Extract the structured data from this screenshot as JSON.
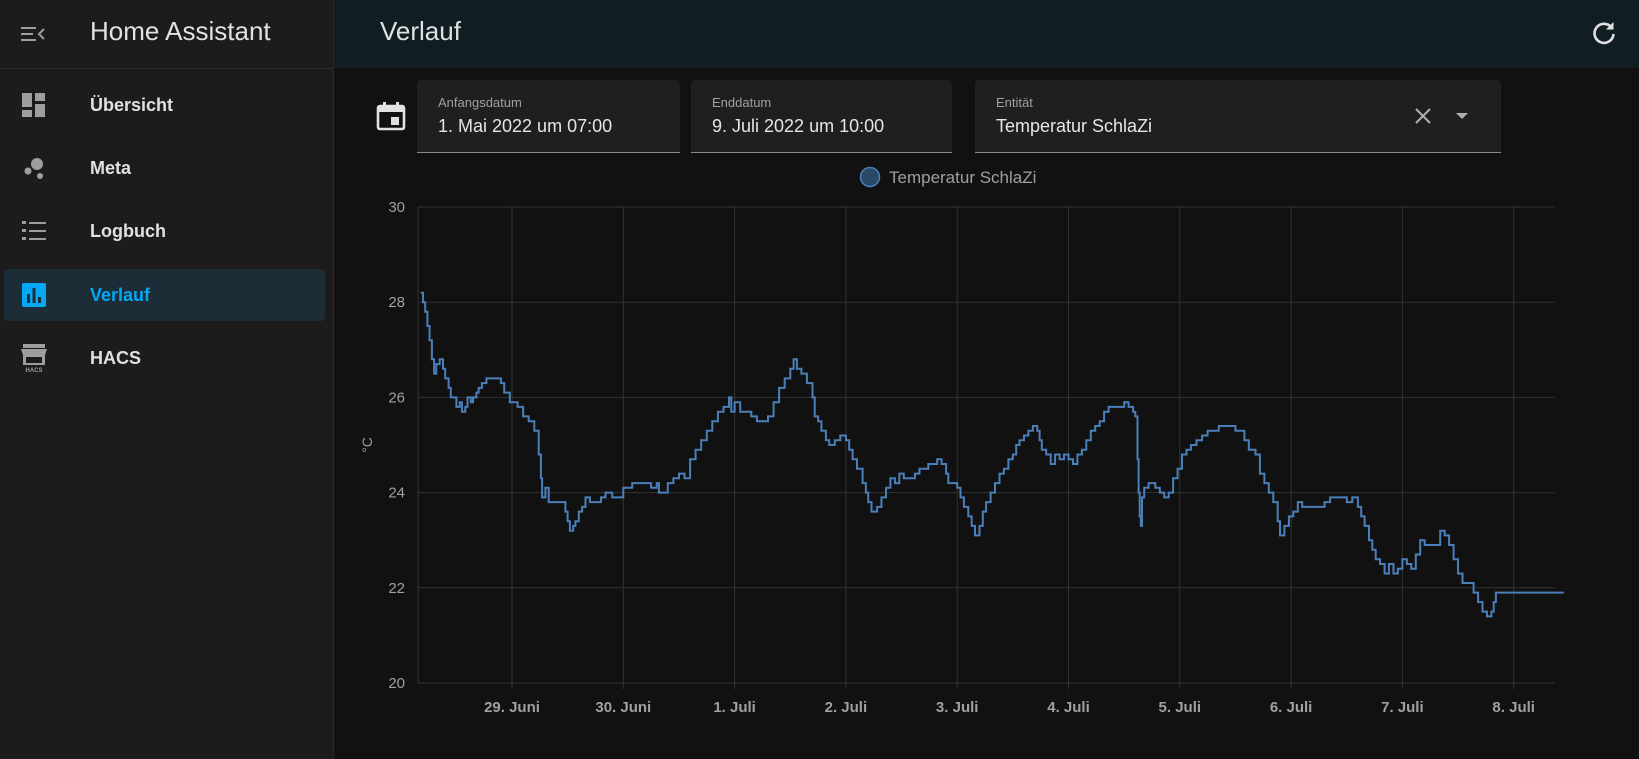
{
  "sidebar": {
    "title": "Home Assistant",
    "menu_icon": "menu-open-icon",
    "items": [
      {
        "label": "Übersicht",
        "icon": "dashboard-icon",
        "active": false
      },
      {
        "label": "Meta",
        "icon": "molecule-icon",
        "active": false
      },
      {
        "label": "Logbuch",
        "icon": "format-list-icon",
        "active": false
      },
      {
        "label": "Verlauf",
        "icon": "chart-box-icon",
        "active": true
      },
      {
        "label": "HACS",
        "icon": "hacs-store-icon",
        "active": false
      }
    ]
  },
  "header": {
    "title": "Verlauf",
    "refresh_icon": "refresh-icon"
  },
  "filters": {
    "calendar_icon": "calendar-icon",
    "start": {
      "label": "Anfangsdatum",
      "value": "1. Mai 2022 um 07:00"
    },
    "end": {
      "label": "Enddatum",
      "value": "9. Juli 2022 um 10:00"
    },
    "entity": {
      "label": "Entität",
      "value": "Temperatur SchlaZi"
    }
  },
  "colors": {
    "accent": "#03a9f4",
    "series": "#4a7fb9",
    "sidebar_bg": "#1c1c1c",
    "topbar_bg": "#101e24",
    "page_bg": "#111111"
  },
  "chart_data": {
    "type": "line",
    "step": true,
    "title": "",
    "xlabel": "",
    "ylabel": "°C",
    "ylim": [
      20,
      30
    ],
    "yticks": [
      20,
      22,
      24,
      26,
      28,
      30
    ],
    "grid": true,
    "legend_position": "top-center",
    "x_ticks": [
      "29. Juni",
      "30. Juni",
      "1. Juli",
      "2. Juli",
      "3. Juli",
      "4. Juli",
      "5. Juli",
      "6. Juli",
      "7. Juli",
      "8. Juli"
    ],
    "x_range_days": [
      -0.82,
      9.45
    ],
    "series": [
      {
        "name": "Temperatur SchlaZi",
        "points": [
          [
            -0.82,
            28.2
          ],
          [
            -0.8,
            28.0
          ],
          [
            -0.78,
            27.8
          ],
          [
            -0.76,
            27.5
          ],
          [
            -0.74,
            27.2
          ],
          [
            -0.72,
            26.8
          ],
          [
            -0.7,
            26.5
          ],
          [
            -0.68,
            26.7
          ],
          [
            -0.65,
            26.8
          ],
          [
            -0.62,
            26.6
          ],
          [
            -0.6,
            26.4
          ],
          [
            -0.57,
            26.2
          ],
          [
            -0.55,
            26.0
          ],
          [
            -0.52,
            26.0
          ],
          [
            -0.5,
            25.8
          ],
          [
            -0.47,
            25.9
          ],
          [
            -0.45,
            25.7
          ],
          [
            -0.42,
            25.8
          ],
          [
            -0.4,
            26.0
          ],
          [
            -0.37,
            25.9
          ],
          [
            -0.35,
            26.0
          ],
          [
            -0.32,
            26.1
          ],
          [
            -0.3,
            26.2
          ],
          [
            -0.27,
            26.3
          ],
          [
            -0.23,
            26.4
          ],
          [
            -0.15,
            26.4
          ],
          [
            -0.1,
            26.3
          ],
          [
            -0.07,
            26.1
          ],
          [
            -0.02,
            25.9
          ],
          [
            0.05,
            25.8
          ],
          [
            0.1,
            25.6
          ],
          [
            0.15,
            25.5
          ],
          [
            0.2,
            25.3
          ],
          [
            0.24,
            24.8
          ],
          [
            0.26,
            24.3
          ],
          [
            0.27,
            23.9
          ],
          [
            0.3,
            24.1
          ],
          [
            0.33,
            23.8
          ],
          [
            0.45,
            23.8
          ],
          [
            0.48,
            23.6
          ],
          [
            0.5,
            23.4
          ],
          [
            0.52,
            23.2
          ],
          [
            0.55,
            23.3
          ],
          [
            0.57,
            23.4
          ],
          [
            0.6,
            23.6
          ],
          [
            0.63,
            23.7
          ],
          [
            0.66,
            23.9
          ],
          [
            0.7,
            23.8
          ],
          [
            0.8,
            23.9
          ],
          [
            0.84,
            24.0
          ],
          [
            0.9,
            23.9
          ],
          [
            1.0,
            24.1
          ],
          [
            1.05,
            24.1
          ],
          [
            1.08,
            24.2
          ],
          [
            1.2,
            24.2
          ],
          [
            1.25,
            24.1
          ],
          [
            1.3,
            24.2
          ],
          [
            1.32,
            24.0
          ],
          [
            1.4,
            24.2
          ],
          [
            1.45,
            24.3
          ],
          [
            1.5,
            24.4
          ],
          [
            1.55,
            24.3
          ],
          [
            1.6,
            24.7
          ],
          [
            1.65,
            24.9
          ],
          [
            1.7,
            25.1
          ],
          [
            1.75,
            25.3
          ],
          [
            1.8,
            25.5
          ],
          [
            1.85,
            25.7
          ],
          [
            1.9,
            25.8
          ],
          [
            1.95,
            26.0
          ],
          [
            1.97,
            25.7
          ],
          [
            2.0,
            25.9
          ],
          [
            2.05,
            25.7
          ],
          [
            2.1,
            25.7
          ],
          [
            2.15,
            25.6
          ],
          [
            2.2,
            25.5
          ],
          [
            2.25,
            25.5
          ],
          [
            2.3,
            25.6
          ],
          [
            2.35,
            25.9
          ],
          [
            2.4,
            26.2
          ],
          [
            2.45,
            26.4
          ],
          [
            2.5,
            26.6
          ],
          [
            2.53,
            26.8
          ],
          [
            2.56,
            26.6
          ],
          [
            2.6,
            26.5
          ],
          [
            2.65,
            26.3
          ],
          [
            2.7,
            26.0
          ],
          [
            2.72,
            25.6
          ],
          [
            2.75,
            25.5
          ],
          [
            2.78,
            25.3
          ],
          [
            2.82,
            25.1
          ],
          [
            2.85,
            25.0
          ],
          [
            2.9,
            25.1
          ],
          [
            2.95,
            25.2
          ],
          [
            3.0,
            25.1
          ],
          [
            3.03,
            24.9
          ],
          [
            3.06,
            24.7
          ],
          [
            3.1,
            24.5
          ],
          [
            3.15,
            24.2
          ],
          [
            3.18,
            24.0
          ],
          [
            3.2,
            23.8
          ],
          [
            3.23,
            23.6
          ],
          [
            3.28,
            23.7
          ],
          [
            3.32,
            23.9
          ],
          [
            3.36,
            24.1
          ],
          [
            3.4,
            24.3
          ],
          [
            3.44,
            24.2
          ],
          [
            3.48,
            24.4
          ],
          [
            3.52,
            24.3
          ],
          [
            3.58,
            24.3
          ],
          [
            3.62,
            24.4
          ],
          [
            3.66,
            24.5
          ],
          [
            3.7,
            24.5
          ],
          [
            3.74,
            24.6
          ],
          [
            3.78,
            24.6
          ],
          [
            3.82,
            24.7
          ],
          [
            3.86,
            24.6
          ],
          [
            3.9,
            24.4
          ],
          [
            3.92,
            24.2
          ],
          [
            3.96,
            24.2
          ],
          [
            4.0,
            24.1
          ],
          [
            4.03,
            23.9
          ],
          [
            4.06,
            23.7
          ],
          [
            4.1,
            23.5
          ],
          [
            4.13,
            23.3
          ],
          [
            4.16,
            23.1
          ],
          [
            4.2,
            23.3
          ],
          [
            4.23,
            23.6
          ],
          [
            4.26,
            23.8
          ],
          [
            4.3,
            24.0
          ],
          [
            4.34,
            24.2
          ],
          [
            4.38,
            24.4
          ],
          [
            4.42,
            24.5
          ],
          [
            4.46,
            24.7
          ],
          [
            4.5,
            24.8
          ],
          [
            4.53,
            25.0
          ],
          [
            4.56,
            25.1
          ],
          [
            4.6,
            25.2
          ],
          [
            4.64,
            25.3
          ],
          [
            4.68,
            25.4
          ],
          [
            4.72,
            25.3
          ],
          [
            4.74,
            25.1
          ],
          [
            4.76,
            24.9
          ],
          [
            4.8,
            24.8
          ],
          [
            4.84,
            24.6
          ],
          [
            4.88,
            24.8
          ],
          [
            4.92,
            24.7
          ],
          [
            4.96,
            24.8
          ],
          [
            5.0,
            24.7
          ],
          [
            5.04,
            24.6
          ],
          [
            5.08,
            24.8
          ],
          [
            5.12,
            24.9
          ],
          [
            5.16,
            25.1
          ],
          [
            5.2,
            25.3
          ],
          [
            5.24,
            25.4
          ],
          [
            5.28,
            25.5
          ],
          [
            5.32,
            25.7
          ],
          [
            5.36,
            25.8
          ],
          [
            5.4,
            25.8
          ],
          [
            5.45,
            25.8
          ],
          [
            5.5,
            25.9
          ],
          [
            5.54,
            25.8
          ],
          [
            5.58,
            25.7
          ],
          [
            5.6,
            25.6
          ],
          [
            5.62,
            24.7
          ],
          [
            5.63,
            24.0
          ],
          [
            5.64,
            23.5
          ],
          [
            5.65,
            23.3
          ],
          [
            5.66,
            23.9
          ],
          [
            5.68,
            24.1
          ],
          [
            5.72,
            24.2
          ],
          [
            5.78,
            24.1
          ],
          [
            5.82,
            24.0
          ],
          [
            5.86,
            23.9
          ],
          [
            5.9,
            24.0
          ],
          [
            5.94,
            24.3
          ],
          [
            5.98,
            24.5
          ],
          [
            6.02,
            24.8
          ],
          [
            6.06,
            24.9
          ],
          [
            6.1,
            25.0
          ],
          [
            6.15,
            25.1
          ],
          [
            6.2,
            25.2
          ],
          [
            6.25,
            25.3
          ],
          [
            6.3,
            25.3
          ],
          [
            6.35,
            25.4
          ],
          [
            6.42,
            25.4
          ],
          [
            6.5,
            25.3
          ],
          [
            6.55,
            25.3
          ],
          [
            6.58,
            25.1
          ],
          [
            6.62,
            24.9
          ],
          [
            6.68,
            24.8
          ],
          [
            6.72,
            24.4
          ],
          [
            6.76,
            24.2
          ],
          [
            6.8,
            24.0
          ],
          [
            6.84,
            23.8
          ],
          [
            6.88,
            23.4
          ],
          [
            6.9,
            23.1
          ],
          [
            6.94,
            23.3
          ],
          [
            6.98,
            23.5
          ],
          [
            7.02,
            23.6
          ],
          [
            7.06,
            23.8
          ],
          [
            7.1,
            23.7
          ],
          [
            7.15,
            23.7
          ],
          [
            7.25,
            23.7
          ],
          [
            7.3,
            23.8
          ],
          [
            7.35,
            23.9
          ],
          [
            7.45,
            23.9
          ],
          [
            7.5,
            23.8
          ],
          [
            7.55,
            23.9
          ],
          [
            7.6,
            23.7
          ],
          [
            7.63,
            23.5
          ],
          [
            7.66,
            23.3
          ],
          [
            7.7,
            23.0
          ],
          [
            7.73,
            22.8
          ],
          [
            7.76,
            22.6
          ],
          [
            7.8,
            22.5
          ],
          [
            7.84,
            22.3
          ],
          [
            7.88,
            22.5
          ],
          [
            7.92,
            22.3
          ],
          [
            7.96,
            22.4
          ],
          [
            8.0,
            22.6
          ],
          [
            8.04,
            22.5
          ],
          [
            8.08,
            22.4
          ],
          [
            8.12,
            22.7
          ],
          [
            8.16,
            23.0
          ],
          [
            8.2,
            22.9
          ],
          [
            8.25,
            22.9
          ],
          [
            8.3,
            22.9
          ],
          [
            8.34,
            23.2
          ],
          [
            8.38,
            23.1
          ],
          [
            8.42,
            22.9
          ],
          [
            8.46,
            22.6
          ],
          [
            8.5,
            22.3
          ],
          [
            8.54,
            22.1
          ],
          [
            8.6,
            22.1
          ],
          [
            8.64,
            21.9
          ],
          [
            8.68,
            21.7
          ],
          [
            8.72,
            21.5
          ],
          [
            8.76,
            21.4
          ],
          [
            8.8,
            21.5
          ],
          [
            8.82,
            21.7
          ],
          [
            8.84,
            21.9
          ]
        ]
      }
    ]
  }
}
